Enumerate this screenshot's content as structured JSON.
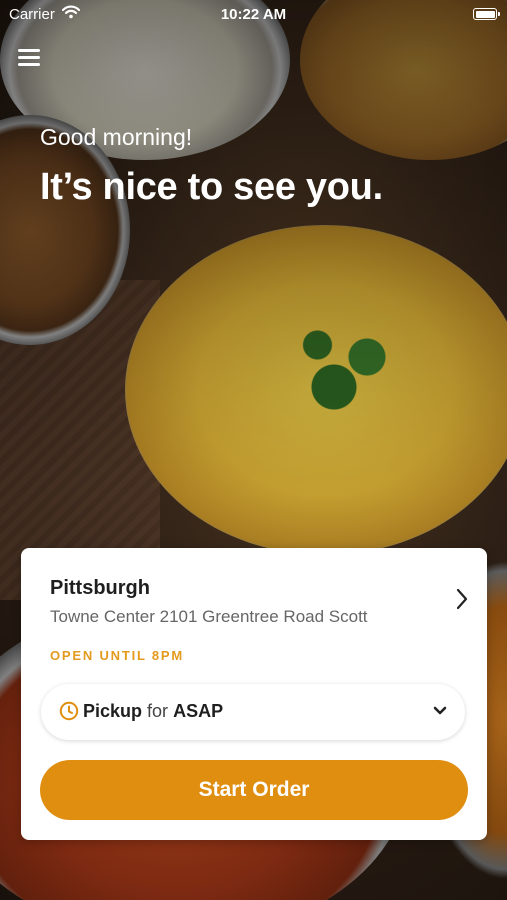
{
  "status_bar": {
    "carrier": "Carrier",
    "time": "10:22 AM"
  },
  "hero": {
    "greeting": "Good morning!",
    "headline": "It’s nice to see you."
  },
  "location": {
    "name": "Pittsburgh",
    "address": "Towne Center 2101 Greentree Road Scott",
    "hours": "OPEN UNTIL 8PM"
  },
  "order_mode": {
    "mode": "Pickup",
    "connector": "for",
    "time": "ASAP"
  },
  "actions": {
    "start_order": "Start Order"
  },
  "icons": {
    "menu": "menu-icon",
    "wifi": "wifi-icon",
    "battery": "battery-icon",
    "chevron_right": "chevron-right-icon",
    "clock": "clock-icon",
    "chevron_down": "chevron-down-icon"
  },
  "colors": {
    "accent": "#e08e10",
    "hours_text": "#e39a1d",
    "card_bg": "#ffffff"
  }
}
